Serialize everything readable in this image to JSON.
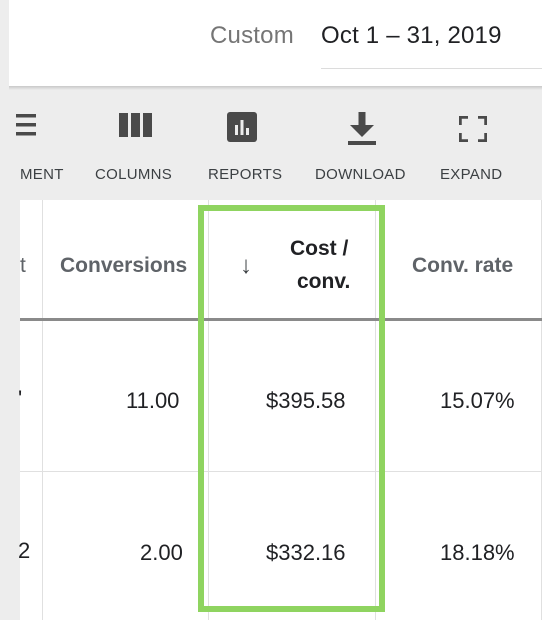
{
  "date_range": {
    "label": "Custom",
    "value": "Oct 1 – 31, 2019"
  },
  "toolbar": {
    "items": [
      {
        "label": "MENT",
        "icon": "segment-icon"
      },
      {
        "label": "COLUMNS",
        "icon": "columns-icon"
      },
      {
        "label": "REPORTS",
        "icon": "reports-icon"
      },
      {
        "label": "DOWNLOAD",
        "icon": "download-icon"
      },
      {
        "label": "EXPAND",
        "icon": "expand-icon"
      }
    ]
  },
  "table": {
    "headers": {
      "partial": "t",
      "conversions": "Conversions",
      "cost_conv_line1": "Cost /",
      "cost_conv_line2": "conv.",
      "conv_rate": "Conv. rate",
      "sort_indicator": "↓"
    },
    "rows": [
      {
        "partial": "'",
        "conversions": "11.00",
        "cost_conv": "$395.58",
        "conv_rate": "15.07%"
      },
      {
        "partial": "2",
        "conversions": "2.00",
        "cost_conv": "$332.16",
        "conv_rate": "18.18%"
      }
    ]
  },
  "colors": {
    "highlight": "#8fd460",
    "icon": "#4a4a4a",
    "header_text": "#5f6368"
  }
}
